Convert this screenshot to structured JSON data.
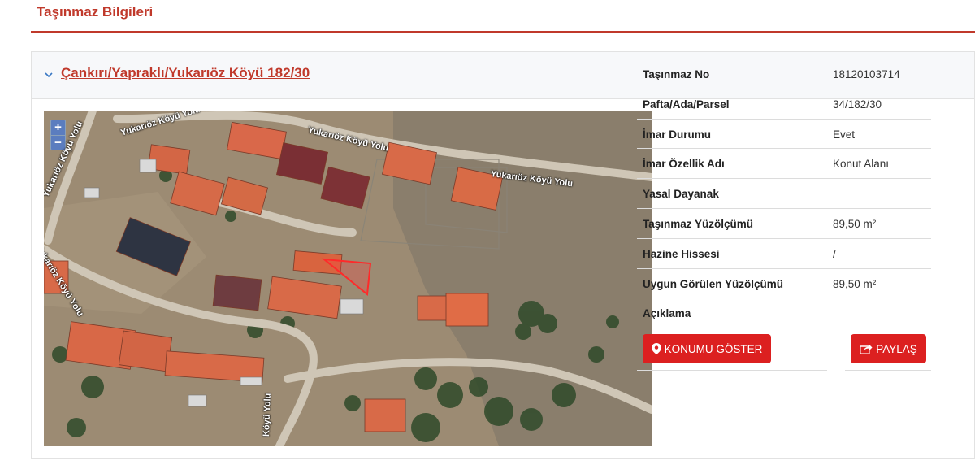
{
  "page": {
    "title": "Taşınmaz Bilgileri"
  },
  "panel": {
    "title": "Çankırı/Yapraklı/Yukarıöz Köyü 182/30"
  },
  "map": {
    "zoom_in": "+",
    "zoom_out": "−",
    "road_labels": [
      "Yukarıöz Köyü Yolu",
      "Yukarıöz Köyü Yolu",
      "Yukarıöz Köyü Yolu",
      "Yukarıöz Köyü Yolu",
      "Yukarıöz Köyü Yolu",
      "Yukarıöz Köyü Yolu",
      "Köyü Yolu"
    ]
  },
  "info": [
    {
      "label": "Taşınmaz No",
      "value": "18120103714"
    },
    {
      "label": "Pafta/Ada/Parsel",
      "value": "34/182/30"
    },
    {
      "label": "İmar Durumu",
      "value": "Evet"
    },
    {
      "label": "İmar Özellik Adı",
      "value": "Konut Alanı"
    },
    {
      "label": "Yasal Dayanak",
      "value": ""
    },
    {
      "label": "Taşınmaz Yüzölçümü",
      "value": "89,50 m²"
    },
    {
      "label": "Hazine Hissesi",
      "value": "/"
    },
    {
      "label": "Uygun Görülen Yüzölçümü",
      "value": "89,50 m²"
    },
    {
      "label": "Açıklama",
      "value": ""
    }
  ],
  "buttons": {
    "location": "KONUMU GÖSTER",
    "share": "PAYLAŞ"
  },
  "colors": {
    "accent": "#c0392b",
    "button": "#dc2020",
    "parcel": "#ff2a2a"
  }
}
